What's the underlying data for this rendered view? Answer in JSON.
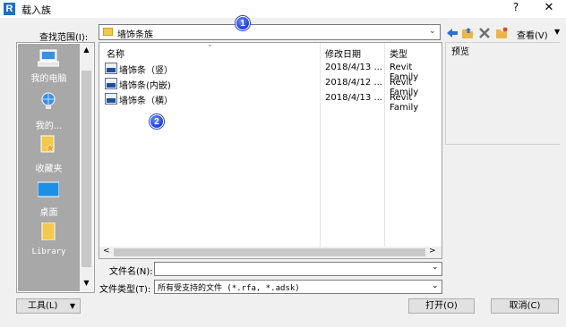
{
  "window": {
    "app_icon_letter": "R",
    "title": "载入族",
    "help_label": "?",
    "close_label": "✕"
  },
  "lookin": {
    "label": "查找范围(I):",
    "value": "墙饰条族",
    "arrow": "⌄"
  },
  "badges": [
    "1",
    "2"
  ],
  "toolbar": {
    "views_label": "查看(V)",
    "views_arrow": "▼",
    "icons": [
      "back-arrow-icon",
      "up-folder-icon",
      "delete-icon",
      "new-folder-icon"
    ]
  },
  "places": [
    {
      "label": "我的电脑",
      "icon": "computer-icon"
    },
    {
      "label": "我的...",
      "icon": "network-icon"
    },
    {
      "label": "收藏夹",
      "icon": "favorites-icon"
    },
    {
      "label": "桌面",
      "icon": "desktop-icon"
    },
    {
      "label": "Library",
      "icon": "library-folder-icon"
    }
  ],
  "places_scroll": {
    "up": "▲",
    "down": "▼"
  },
  "filelist": {
    "columns": [
      "名称",
      "修改日期",
      "类型"
    ],
    "sort_arrow": "⌄",
    "rows": [
      {
        "name": "墙饰条（竖）",
        "date": "2018/4/13 ...",
        "type": "Revit Family"
      },
      {
        "name": "墙饰条(内嵌)",
        "date": "2018/4/12 ...",
        "type": "Revit Family"
      },
      {
        "name": "墙饰条（横）",
        "date": "2018/4/13 ...",
        "type": "Revit Family"
      }
    ],
    "hscroll": {
      "left": "<",
      "right": ">"
    }
  },
  "preview": {
    "label": "预览"
  },
  "filename": {
    "label": "文件名(N):",
    "value": "",
    "arrow": "⌄"
  },
  "filetype": {
    "label": "文件类型(T):",
    "value": "所有受支持的文件 (*.rfa, *.adsk)",
    "arrow": "⌄"
  },
  "buttons": {
    "tools": "工具(L)",
    "tools_arrow": "▼",
    "open": "打开(O)",
    "cancel": "取消(C)"
  },
  "colors": {
    "accent": "#1f6fc1",
    "places_bg": "#a8a8a8",
    "badge": "#1d3fcf"
  }
}
